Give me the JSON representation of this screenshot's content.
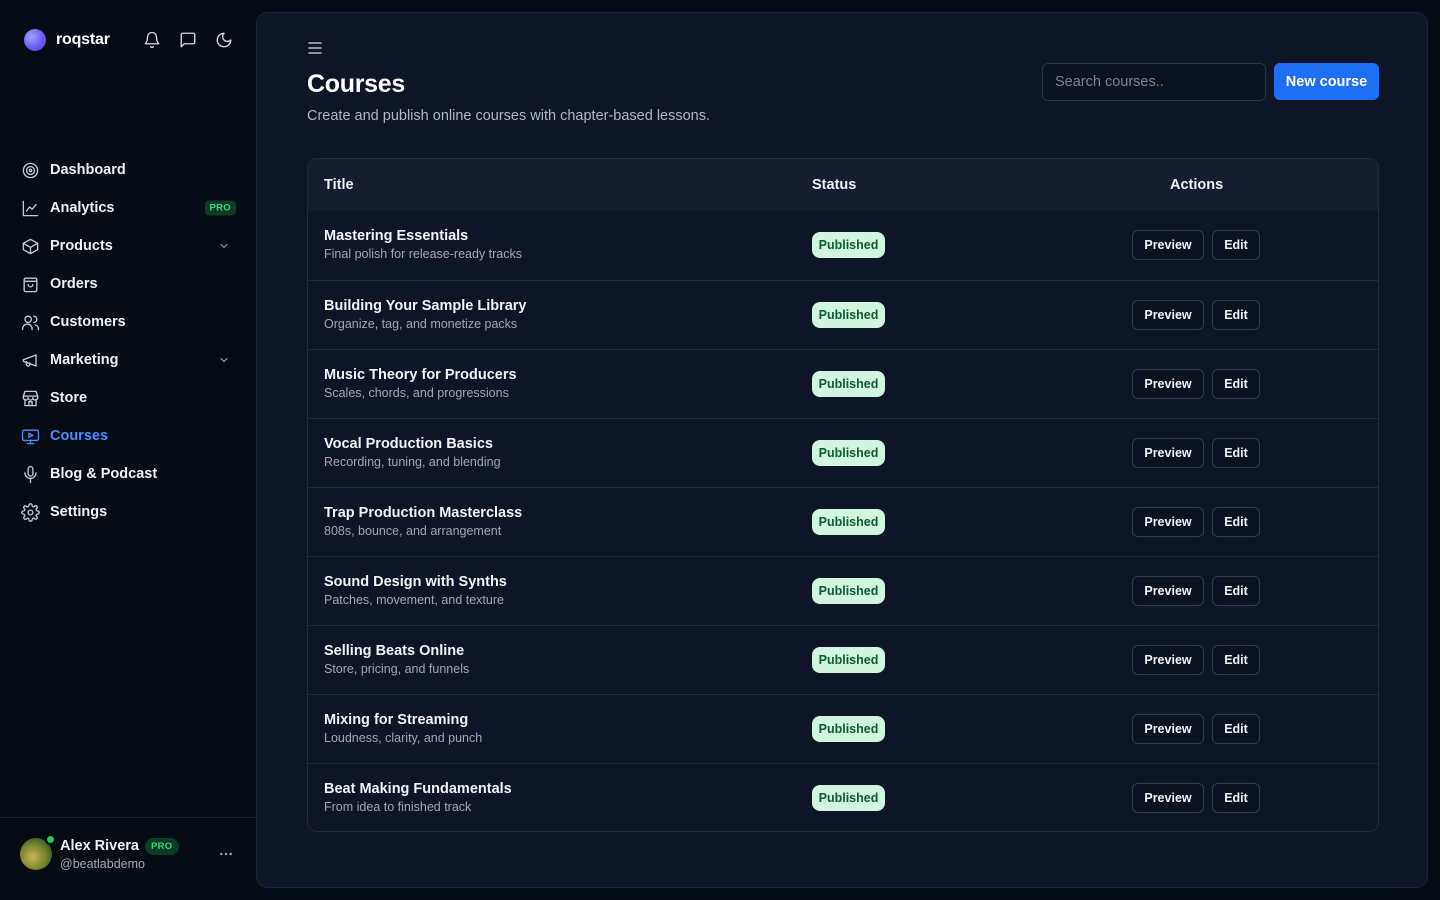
{
  "app": {
    "name": "roqstar"
  },
  "sidebar": {
    "items": [
      {
        "label": "Dashboard",
        "icon": "target-icon"
      },
      {
        "label": "Analytics",
        "icon": "chart-line-icon",
        "badge": "PRO"
      },
      {
        "label": "Products",
        "icon": "box-icon",
        "expandable": true
      },
      {
        "label": "Orders",
        "icon": "shopping-bag-icon"
      },
      {
        "label": "Customers",
        "icon": "users-icon"
      },
      {
        "label": "Marketing",
        "icon": "megaphone-icon",
        "expandable": true
      },
      {
        "label": "Store",
        "icon": "store-icon"
      },
      {
        "label": "Courses",
        "icon": "presentation-icon",
        "active": true
      },
      {
        "label": "Blog & Podcast",
        "icon": "microphone-icon"
      },
      {
        "label": "Settings",
        "icon": "gear-icon"
      }
    ]
  },
  "user": {
    "name": "Alex Rivera",
    "badge": "PRO",
    "handle": "@beatlabdemo"
  },
  "page": {
    "title": "Courses",
    "subtitle": "Create and publish online courses with chapter-based lessons.",
    "search_placeholder": "Search courses..",
    "new_button": "New course"
  },
  "table": {
    "headers": {
      "title": "Title",
      "status": "Status",
      "actions": "Actions"
    },
    "rows": [
      {
        "title": "Mastering Essentials",
        "subtitle": "Final polish for release-ready tracks",
        "status": "Published",
        "preview": "Preview",
        "edit": "Edit"
      },
      {
        "title": "Building Your Sample Library",
        "subtitle": "Organize, tag, and monetize packs",
        "status": "Published",
        "preview": "Preview",
        "edit": "Edit"
      },
      {
        "title": "Music Theory for Producers",
        "subtitle": "Scales, chords, and progressions",
        "status": "Published",
        "preview": "Preview",
        "edit": "Edit"
      },
      {
        "title": "Vocal Production Basics",
        "subtitle": "Recording, tuning, and blending",
        "status": "Published",
        "preview": "Preview",
        "edit": "Edit"
      },
      {
        "title": "Trap Production Masterclass",
        "subtitle": "808s, bounce, and arrangement",
        "status": "Published",
        "preview": "Preview",
        "edit": "Edit"
      },
      {
        "title": "Sound Design with Synths",
        "subtitle": "Patches, movement, and texture",
        "status": "Published",
        "preview": "Preview",
        "edit": "Edit"
      },
      {
        "title": "Selling Beats Online",
        "subtitle": "Store, pricing, and funnels",
        "status": "Published",
        "preview": "Preview",
        "edit": "Edit"
      },
      {
        "title": "Mixing for Streaming",
        "subtitle": "Loudness, clarity, and punch",
        "status": "Published",
        "preview": "Preview",
        "edit": "Edit"
      },
      {
        "title": "Beat Making Fundamentals",
        "subtitle": "From idea to finished track",
        "status": "Published",
        "preview": "Preview",
        "edit": "Edit"
      }
    ]
  },
  "colors": {
    "accent": "#1f6ff5",
    "active_nav": "#4a8cff",
    "published_bg": "#d2f5df",
    "published_text": "#0b5b33",
    "pro_text": "#37d67a"
  }
}
